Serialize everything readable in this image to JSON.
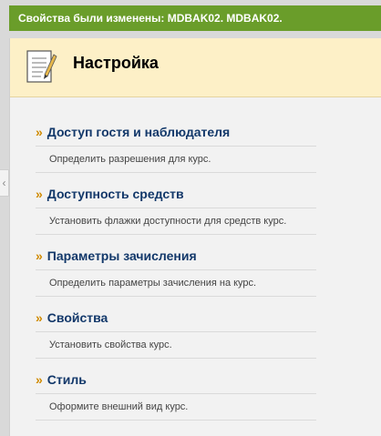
{
  "notification": {
    "message": "Свойства были изменены: MDBAK02. MDBAK02."
  },
  "panel": {
    "title": "Настройка",
    "icon": "document-pencil-icon",
    "items": [
      {
        "label": "Доступ гостя и наблюдателя",
        "description": "Определить разрешения для курс."
      },
      {
        "label": "Доступность средств",
        "description": "Установить флажки доступности для средств курс."
      },
      {
        "label": "Параметры зачисления",
        "description": "Определить параметры зачисления на курс."
      },
      {
        "label": "Свойства",
        "description": "Установить свойства курс."
      },
      {
        "label": "Стиль",
        "description": "Оформите внешний вид курс."
      }
    ]
  },
  "sidebar_toggle": {
    "icon": "chevron-left-icon",
    "glyph": "‹"
  },
  "colors": {
    "banner": "#6a9d2a",
    "header_bg": "#fdf0c7",
    "link": "#12386a",
    "bullet": "#d08a00"
  }
}
